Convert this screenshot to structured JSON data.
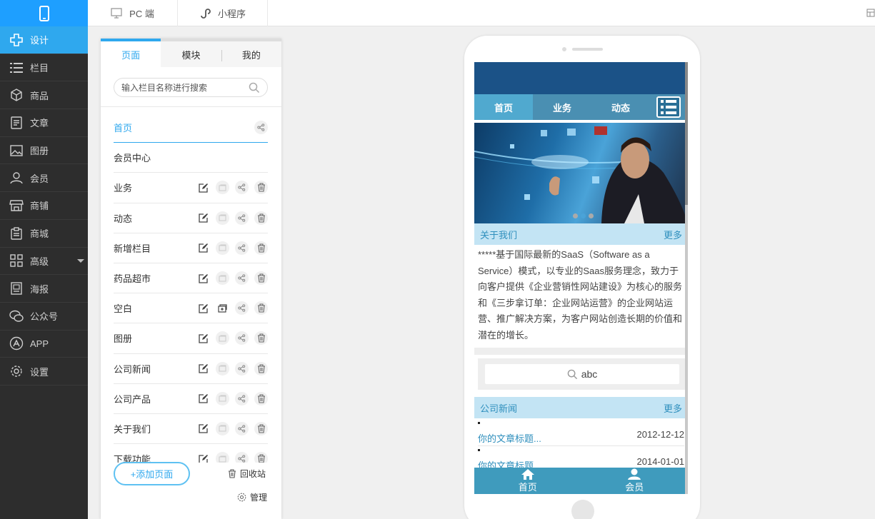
{
  "nav": {
    "items": [
      {
        "label": "设计",
        "icon": "design-icon",
        "active": true
      },
      {
        "label": "栏目",
        "icon": "list-icon"
      },
      {
        "label": "商品",
        "icon": "box-icon"
      },
      {
        "label": "文章",
        "icon": "article-icon"
      },
      {
        "label": "图册",
        "icon": "image-icon"
      },
      {
        "label": "会员",
        "icon": "user-icon"
      },
      {
        "label": "商铺",
        "icon": "shop-icon"
      },
      {
        "label": "商城",
        "icon": "clipboard-icon"
      },
      {
        "label": "高级",
        "icon": "grid-icon"
      },
      {
        "label": "海报",
        "icon": "poster-icon"
      },
      {
        "label": "公众号",
        "icon": "wechat-icon"
      },
      {
        "label": "APP",
        "icon": "app-icon"
      },
      {
        "label": "设置",
        "icon": "gear-icon"
      }
    ]
  },
  "topbar": {
    "tabs": [
      {
        "label": "PC 端",
        "icon": "monitor-icon"
      },
      {
        "label": "小程序",
        "icon": "miniprogram-icon"
      }
    ]
  },
  "panel": {
    "tabs": [
      "页面",
      "模块",
      "我的"
    ],
    "search_placeholder": "输入栏目名称进行搜索",
    "rows": [
      {
        "label": "首页"
      },
      {
        "label": "会员中心"
      },
      {
        "label": "业务"
      },
      {
        "label": "动态"
      },
      {
        "label": "新增栏目"
      },
      {
        "label": "药品超市"
      },
      {
        "label": "空白"
      },
      {
        "label": "图册"
      },
      {
        "label": "公司新闻"
      },
      {
        "label": "公司产品"
      },
      {
        "label": "关于我们"
      },
      {
        "label": "下载功能"
      }
    ],
    "add_page": "+添加页面",
    "recycle": "回收站",
    "manage": "管理"
  },
  "phone": {
    "nav": [
      "首页",
      "业务",
      "动态"
    ],
    "about": {
      "title": "关于我们",
      "more": "更多",
      "text": "*****基于国际最新的SaaS（Software as a Service）模式，以专业的Saas服务理念，致力于向客户提供《企业营销性网站建设》为核心的服务和《三步拿订单：企业网站运营》的企业网站运营、推广解决方案，为客户网站创造长期的价值和潜在的增长。"
    },
    "search_value": "abc",
    "news": {
      "title": "公司新闻",
      "more": "更多",
      "items": [
        {
          "title": "你的文章标题...",
          "date": "2012-12-12"
        },
        {
          "title": "你的文章标题...",
          "date": "2014-01-01"
        }
      ]
    },
    "footer": [
      "首页",
      "会员"
    ],
    "colors": {
      "header": "#1b5287",
      "nav": "#4a8fb2",
      "accent": "#2fa8ee"
    }
  }
}
